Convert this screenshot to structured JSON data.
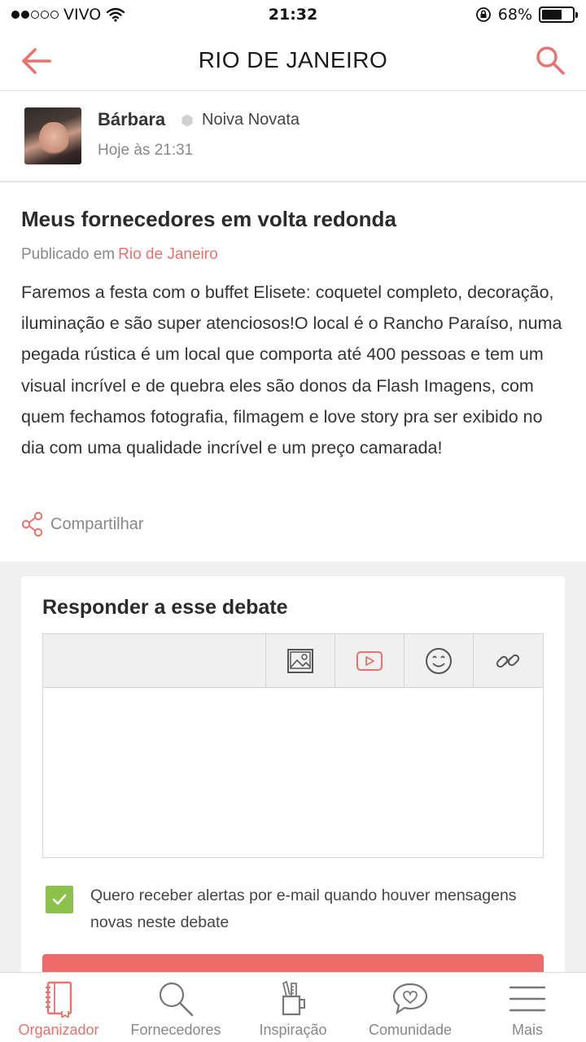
{
  "status_bar": {
    "carrier": "VIVO",
    "time": "21:32",
    "battery": "68%",
    "battery_level": 0.68,
    "signal_full": 2,
    "signal_total": 5
  },
  "header": {
    "title": "RIO DE JANEIRO",
    "back_icon": "arrow-left-icon",
    "search_icon": "search-icon"
  },
  "author": {
    "name": "Bárbara",
    "rank": "Noiva Novata",
    "time": "Hoje às 21:31"
  },
  "post": {
    "title": "Meus fornecedores em volta redonda",
    "published_prefix": "Publicado em",
    "published_location": "Rio de Janeiro",
    "body": "Faremos a festa com o buffet Elisete: coquetel completo, decoração, iluminação e são super atenciosos!O local é o Rancho Paraíso, numa pegada rústica é um local que comporta até 400 pessoas e tem um visual incrível e de quebra eles são donos da Flash Imagens, com quem fechamos fotografia, filmagem e love story pra ser exibido no dia com uma qualidade incrível e um preço camarada!",
    "share_label": "Compartilhar"
  },
  "reply": {
    "title": "Responder a esse debate",
    "tools": [
      "image-icon",
      "video-icon",
      "emoji-icon",
      "link-icon"
    ],
    "alert_checked": true,
    "alert_text": "Quero receber alertas por e-mail quando houver mensagens novas neste debate"
  },
  "bottom_nav": {
    "items": [
      {
        "label": "Organizador",
        "icon": "planner-icon",
        "active": true
      },
      {
        "label": "Fornecedores",
        "icon": "search-icon",
        "active": false
      },
      {
        "label": "Inspiração",
        "icon": "pencil-cup-icon",
        "active": false
      },
      {
        "label": "Comunidade",
        "icon": "heart-bubble-icon",
        "active": false
      },
      {
        "label": "Mais",
        "icon": "menu-icon",
        "active": false
      }
    ]
  },
  "colors": {
    "accent": "#e8726e",
    "check_green": "#8bc34a",
    "submit_red": "#ee6b6b"
  }
}
